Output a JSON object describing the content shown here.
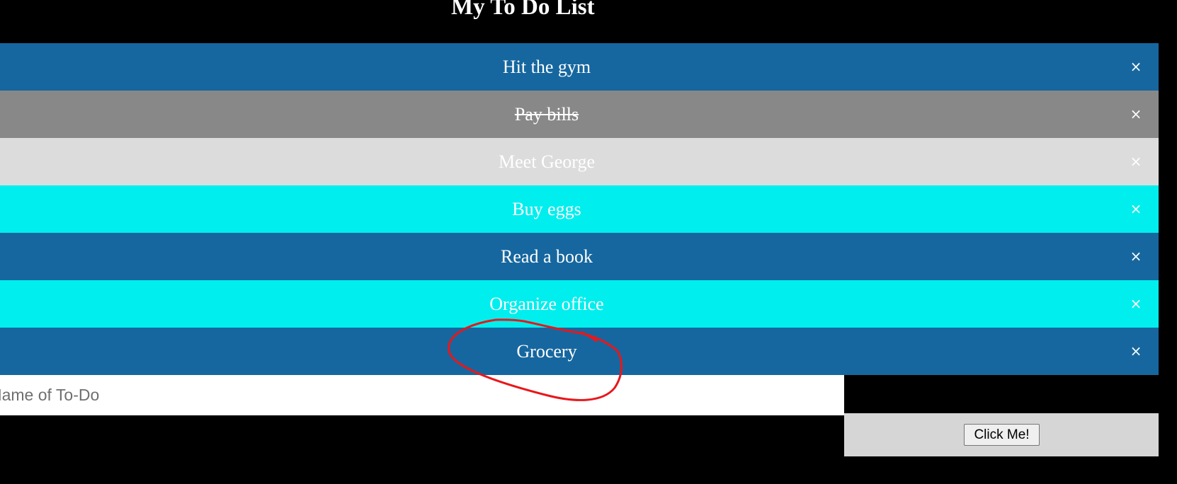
{
  "page": {
    "title": "My To Do List"
  },
  "todos": [
    {
      "text": "Hit the gym",
      "checked": false,
      "color": "#16679f",
      "close": "×"
    },
    {
      "text": "Pay bills",
      "checked": true,
      "color": "#888888",
      "close": "×"
    },
    {
      "text": "Meet George",
      "checked": false,
      "color": "#dcdcdc",
      "close": "×"
    },
    {
      "text": "Buy eggs",
      "checked": false,
      "color": "#00eeee",
      "close": "×"
    },
    {
      "text": "Read a book",
      "checked": false,
      "color": "#16679f",
      "close": "×"
    },
    {
      "text": "Organize office",
      "checked": false,
      "color": "#00eeee",
      "close": "×"
    },
    {
      "text": "Grocery",
      "checked": false,
      "color": "#16679f",
      "close": "×"
    }
  ],
  "input": {
    "placeholder": "Name of To-Do",
    "value": ""
  },
  "add_button": {
    "label": "Click Me!"
  },
  "annotation": {
    "type": "hand-drawn circle",
    "color": "#e8171b",
    "target": "Grocery"
  }
}
